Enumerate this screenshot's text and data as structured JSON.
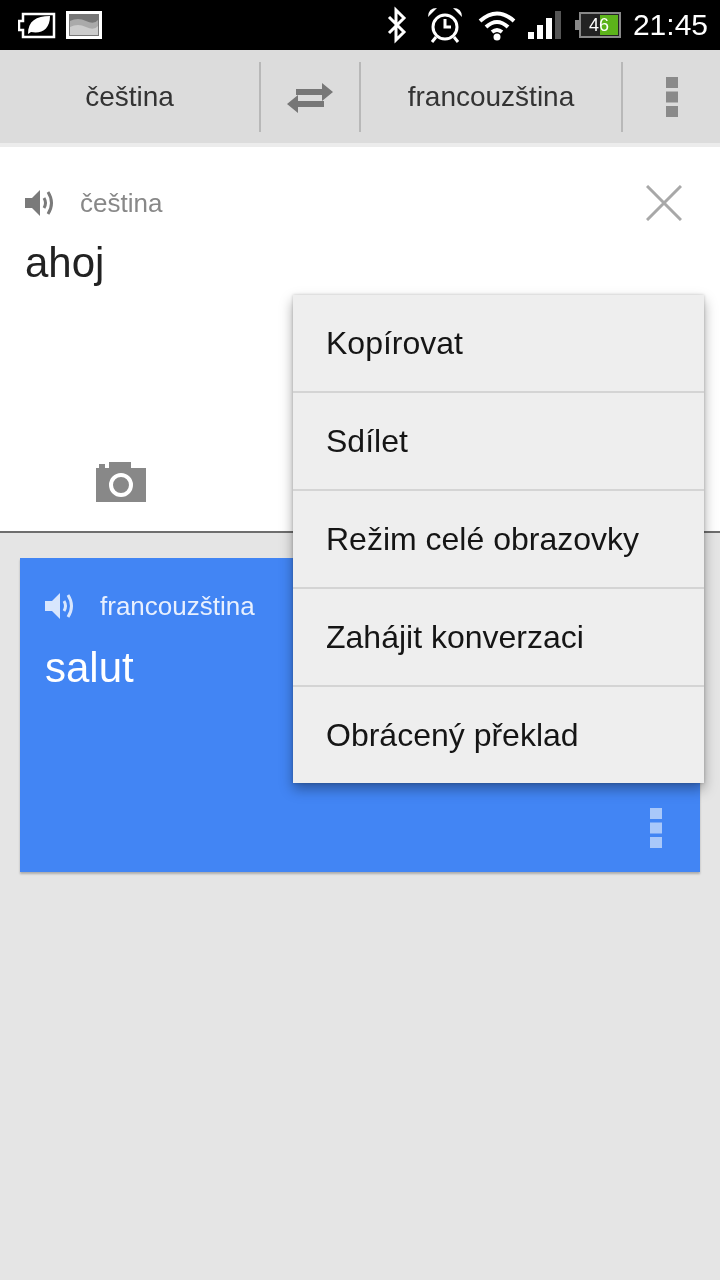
{
  "status_bar": {
    "battery": "46",
    "time": "21:45"
  },
  "toolbar": {
    "source_language": "čeština",
    "target_language": "francouzština"
  },
  "input_card": {
    "language": "čeština",
    "text": "ahoj"
  },
  "translation_card": {
    "language": "francouzština",
    "text": "salut"
  },
  "context_menu": {
    "items": [
      "Kopírovat",
      "Sdílet",
      "Režim celé obrazovky",
      "Zahájit konverzaci",
      "Obrácený překlad"
    ]
  }
}
